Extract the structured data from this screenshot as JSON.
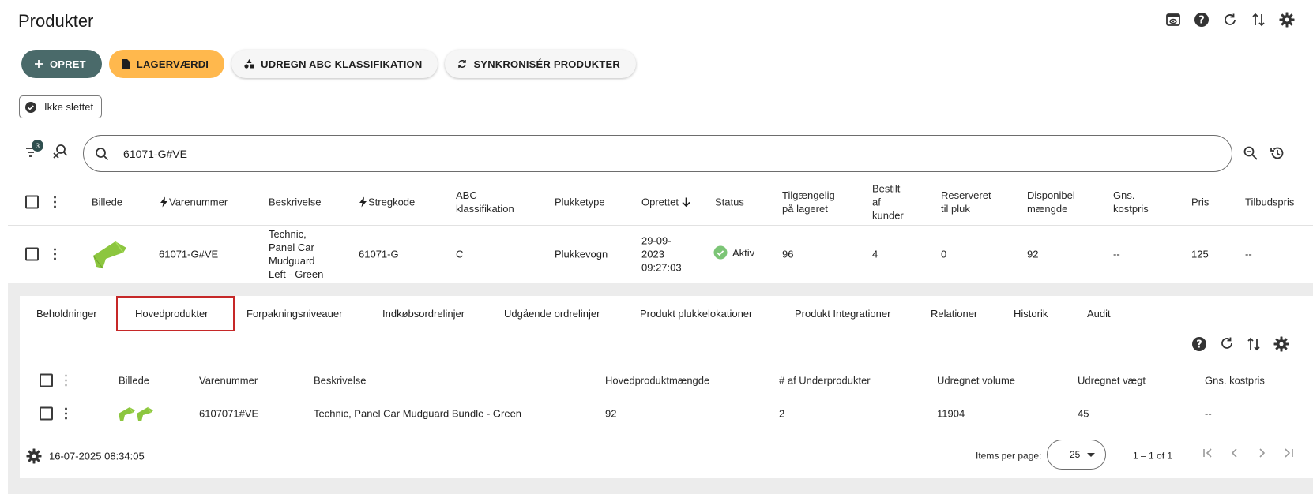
{
  "header": {
    "title": "Produkter"
  },
  "actions": {
    "create": "OPRET",
    "stock_value": "LAGERVÆRDI",
    "abc": "UDREGN ABC KLASSIFIKATION",
    "sync": "SYNKRONISÉR PRODUKTER"
  },
  "filter_chip": "Ikke slettet",
  "filter_count": "3",
  "search": {
    "value": "61071-G#VE"
  },
  "main_table": {
    "headers": {
      "image": "Billede",
      "item_no": "Varenummer",
      "description": "Beskrivelse",
      "barcode": "Stregkode",
      "abc_l1": "ABC",
      "abc_l2": "klassifikation",
      "pick_type": "Plukketype",
      "created": "Oprettet",
      "status": "Status",
      "avail_l1": "Tilgængelig",
      "avail_l2": "på lageret",
      "ordered_l1": "Bestilt",
      "ordered_l2": "af",
      "ordered_l3": "kunder",
      "reserved_l1": "Reserveret",
      "reserved_l2": "til pluk",
      "disp_l1": "Disponibel",
      "disp_l2": "mængde",
      "cost_l1": "Gns.",
      "cost_l2": "kostpris",
      "price": "Pris",
      "offer": "Tilbudspris"
    },
    "row": {
      "item_no": "61071-G#VE",
      "desc_l1": "Technic,",
      "desc_l2": "Panel Car",
      "desc_l3": "Mudguard",
      "desc_l4": "Left - Green",
      "barcode": "61071-G",
      "abc": "C",
      "pick_type": "Plukkevogn",
      "created_l1": "29-09-",
      "created_l2": "2023",
      "created_l3": "09:27:03",
      "status": "Aktiv",
      "available": "96",
      "ordered": "4",
      "reserved": "0",
      "disposable": "92",
      "avg_cost": "--",
      "price": "125",
      "offer_price": "--"
    }
  },
  "tabs": [
    "Beholdninger",
    "Hovedprodukter",
    "Forpakningsniveauer",
    "Indkøbsordrelinjer",
    "Udgående ordrelinjer",
    "Produkt plukkelokationer",
    "Produkt Integrationer",
    "Relationer",
    "Historik",
    "Audit"
  ],
  "sub_table": {
    "headers": {
      "image": "Billede",
      "item_no": "Varenummer",
      "description": "Beskrivelse",
      "main_qty": "Hovedproduktmængde",
      "sub_count": "# af Underprodukter",
      "volume": "Udregnet volume",
      "weight": "Udregnet vægt",
      "avg_cost": "Gns. kostpris"
    },
    "row": {
      "item_no": "6107071#VE",
      "description": "Technic, Panel Car Mudguard Bundle - Green",
      "main_qty": "92",
      "sub_count": "2",
      "volume": "11904",
      "weight": "45",
      "avg_cost": "--"
    }
  },
  "footer": {
    "timestamp": "16-07-2025 08:34:05",
    "items_per_page_label": "Items per page:",
    "items_per_page": "25",
    "range": "1 – 1 of 1"
  },
  "colors": {
    "primary": "#4a6a6a",
    "warning": "#ffb84d",
    "active_tab_border": "#c62828",
    "status_active": "#7cc576",
    "product_green": "#8cc63f"
  }
}
